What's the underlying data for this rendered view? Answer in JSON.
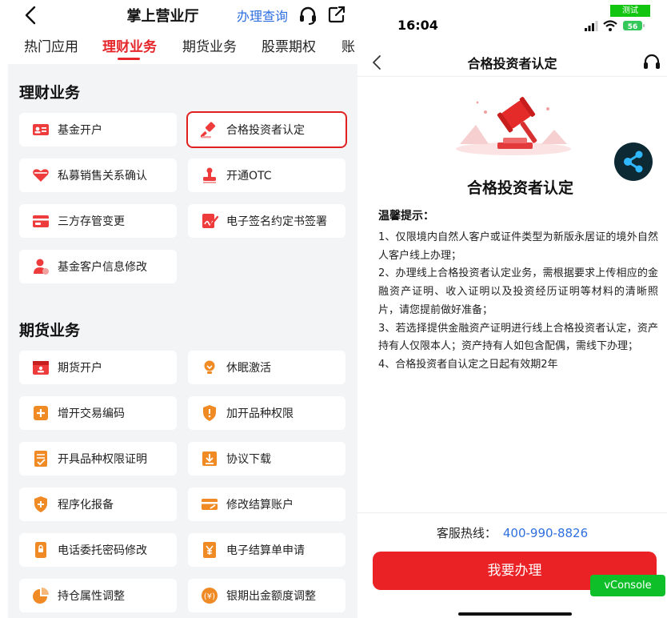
{
  "left": {
    "header": {
      "title": "掌上营业厅",
      "query_link": "办理查询"
    },
    "tabs": [
      {
        "label": "热门应用",
        "active": false
      },
      {
        "label": "理财业务",
        "active": true
      },
      {
        "label": "期货业务",
        "active": false
      },
      {
        "label": "股票期权",
        "active": false
      },
      {
        "label": "账",
        "active": false
      }
    ],
    "wealth": {
      "title": "理财业务",
      "items": [
        {
          "label": "基金开户",
          "icon": "id-card-icon"
        },
        {
          "label": "合格投资者认定",
          "icon": "gavel-icon",
          "highlighted": true
        },
        {
          "label": "私募销售关系确认",
          "icon": "heart-icon"
        },
        {
          "label": "开通OTC",
          "icon": "stamp-icon"
        },
        {
          "label": "三方存管变更",
          "icon": "bank-card-icon"
        },
        {
          "label": "电子签名约定书签署",
          "icon": "e-sign-icon"
        },
        {
          "label": "基金客户信息修改",
          "icon": "user-edit-icon"
        }
      ]
    },
    "futures": {
      "title": "期货业务",
      "items": [
        {
          "label": "期货开户",
          "icon": "calendar-icon"
        },
        {
          "label": "休眠激活",
          "icon": "bulb-icon"
        },
        {
          "label": "增开交易编码",
          "icon": "plus-icon"
        },
        {
          "label": "加开品种权限",
          "icon": "shield-icon"
        },
        {
          "label": "开具品种权限证明",
          "icon": "certificate-icon"
        },
        {
          "label": "协议下载",
          "icon": "download-icon"
        },
        {
          "label": "程序化报备",
          "icon": "shield-plus-icon"
        },
        {
          "label": "修改结算账户",
          "icon": "card-edit-icon"
        },
        {
          "label": "电话委托密码修改",
          "icon": "phone-lock-icon"
        },
        {
          "label": "电子结算单申请",
          "icon": "yen-doc-icon"
        },
        {
          "label": "持仓属性调整",
          "icon": "pie-icon"
        },
        {
          "label": "银期出金额度调整",
          "icon": "yen-circle-icon"
        }
      ]
    }
  },
  "right": {
    "status": {
      "time": "16:04",
      "test_badge": "测试",
      "battery": "56"
    },
    "nav": {
      "title": "合格投资者认定"
    },
    "heading": "合格投资者认定",
    "tips_title": "温馨提示：",
    "tips": [
      "1、仅限境内自然人客户或证件类型为新版永居证的境外自然人客户线上办理；",
      "2、办理线上合格投资者认定业务，需根据要求上传相应的金融资产证明、收入证明以及投资经历证明等材料的清晰照片，请您提前做好准备；",
      "3、若选择提供金融资产证明进行线上合格投资者认定，资产持有人仅限本人；资产持有人如包含配偶，需线下办理；",
      "4、合格投资者自认定之日起有效期2年"
    ],
    "hotline_label": "客服热线：",
    "hotline_number": "400-990-8826",
    "apply_button": "我要办理",
    "vconsole": "vConsole"
  },
  "colors": {
    "accent_red": "#e5262b",
    "link_blue": "#2f6fe0",
    "vconsole_green": "#0fbf2a"
  }
}
